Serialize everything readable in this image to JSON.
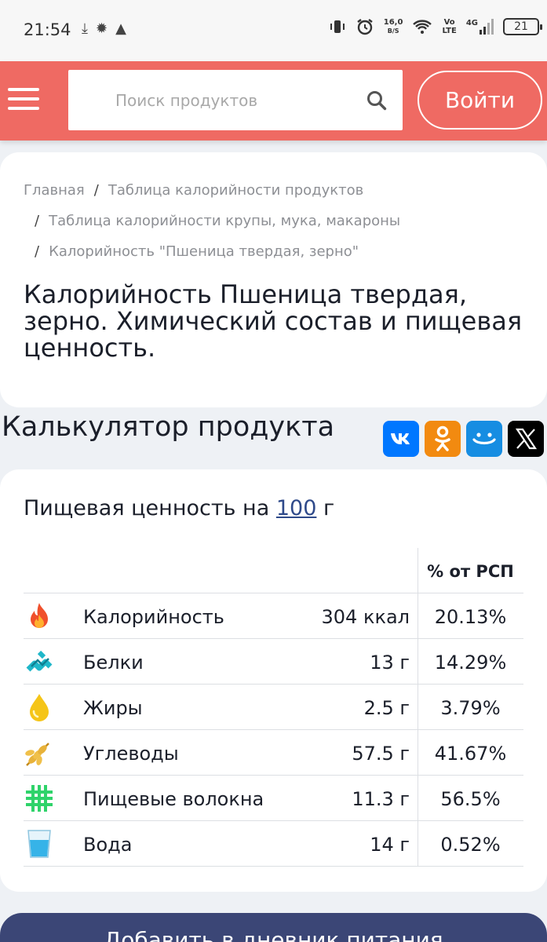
{
  "status_bar": {
    "time": "21:54",
    "net_speed_value": "16,0",
    "net_speed_unit": "B/S",
    "volte_top": "Vo",
    "volte_bottom": "LTE",
    "network": "4G",
    "battery": "21"
  },
  "header": {
    "search_placeholder": "Поиск продуктов",
    "login_label": "Войти",
    "accent_color": "#ef6a63"
  },
  "breadcrumb": {
    "home": "Главная",
    "level1": "Таблица калорийности продуктов",
    "level2": "Таблица калорийности крупы, мука, макароны",
    "level3": "Калорийность \"Пшеница твердая, зерно\""
  },
  "page_title": "Калорийность Пшеница твердая, зерно. Химический состав и пищевая ценность.",
  "calculator_title": "Калькулятор продукта",
  "share": {
    "vk": "vk-icon",
    "ok": "odnoklassniki-icon",
    "mm": "moimir-icon",
    "x": "x-icon"
  },
  "nutrition": {
    "heading_prefix": "Пищевая ценность на",
    "amount": "100",
    "unit": "г",
    "pct_header": "% от РСП",
    "rows": [
      {
        "icon": "fire-icon",
        "name": "Калорийность",
        "value": "304 ккал",
        "pct": "20.13%"
      },
      {
        "icon": "protein-icon",
        "name": "Белки",
        "value": "13 г",
        "pct": "14.29%"
      },
      {
        "icon": "fat-drop-icon",
        "name": "Жиры",
        "value": "2.5 г",
        "pct": "3.79%"
      },
      {
        "icon": "wheat-icon",
        "name": "Углеводы",
        "value": "57.5 г",
        "pct": "41.67%"
      },
      {
        "icon": "fiber-icon",
        "name": "Пищевые волокна",
        "value": "11.3 г",
        "pct": "56.5%"
      },
      {
        "icon": "water-glass-icon",
        "name": "Вода",
        "value": "14 г",
        "pct": "0.52%"
      }
    ]
  },
  "diary_button": "Добавить в дневник питания"
}
